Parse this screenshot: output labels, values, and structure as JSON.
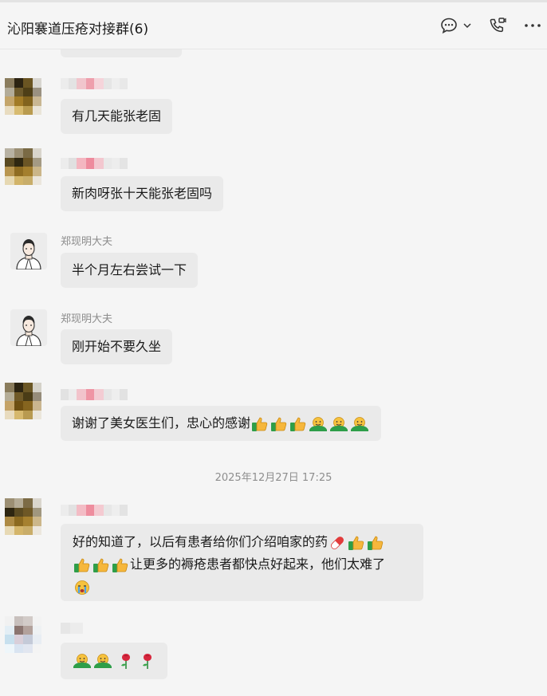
{
  "window": {
    "title": "沁阳褰道压疮对接群(6)"
  },
  "header_icons": {
    "chat": "chat-bubble-icon",
    "chevron": "chevron-down-icon",
    "video": "video-call-icon",
    "more": "more-icon"
  },
  "messages": [
    {
      "sender": "",
      "text": "有几天能张老固"
    },
    {
      "sender": "",
      "text": "新肉呀张十天能张老固吗"
    },
    {
      "sender": "郑现明大夫",
      "text": "半个月左右尝试一下"
    },
    {
      "sender": "郑现明大夫",
      "text": "刚开始不要久坐"
    },
    {
      "sender": "",
      "text": "谢谢了美女医生们，忠心的感谢",
      "emojis": [
        "thumbs-up",
        "thumbs-up",
        "thumbs-up",
        "hug",
        "hug",
        "hug"
      ]
    },
    {
      "sender": "",
      "text_line1": "好的知道了，以后有患者给你们介绍咱家的药",
      "line1_emojis": [
        "pill",
        "thumbs-up",
        "thumbs-up"
      ],
      "line2_emojis": [
        "thumbs-up",
        "thumbs-up",
        "thumbs-up"
      ],
      "text_line2": "让更多的褥疮患者都快点好起来，他们太难了",
      "line3_emojis": [
        "crying"
      ]
    },
    {
      "sender": "",
      "emojis": [
        "hug",
        "hug",
        "rose",
        "rose"
      ]
    }
  ],
  "timestamp": "2025年12月27日 17:25",
  "colors": {
    "background": "#f5f5f5",
    "bubble": "#eaeaea",
    "sender_name": "#8c8c8c",
    "timestamp": "#8e8e8e"
  }
}
